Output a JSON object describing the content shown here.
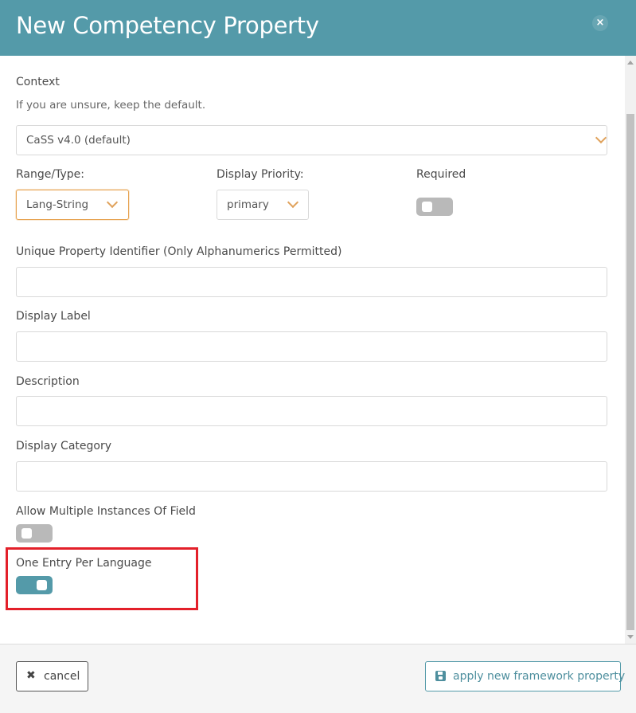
{
  "dialog": {
    "title": "New Competency Property",
    "close_glyph": "×"
  },
  "context": {
    "label": "Context",
    "help": "If you are unsure, keep the default.",
    "selected": "CaSS v4.0 (default)"
  },
  "range_type": {
    "label": "Range/Type:",
    "selected": "Lang-String"
  },
  "display_priority": {
    "label": "Display Priority:",
    "selected": "primary"
  },
  "required": {
    "label": "Required",
    "on": false
  },
  "fields": {
    "unique_id_label": "Unique Property Identifier (Only Alphanumerics Permitted)",
    "unique_id_value": "",
    "display_label_label": "Display Label",
    "display_label_value": "",
    "description_label": "Description",
    "description_value": "",
    "display_category_label": "Display Category",
    "display_category_value": ""
  },
  "allow_multiple": {
    "label": "Allow Multiple Instances Of Field",
    "on": false
  },
  "one_entry_per_language": {
    "label": "One Entry Per Language",
    "on": true
  },
  "footer": {
    "cancel_label": "cancel",
    "cancel_glyph": "✖",
    "apply_label": "apply new framework property"
  },
  "colors": {
    "header": "#549aa9",
    "accent": "#549aa9",
    "chevron": "#e0a25c",
    "highlight_box": "#e3202a"
  },
  "icons": {
    "close": "close-icon",
    "chevron": "chevron-down-icon",
    "cancel": "x-icon",
    "apply": "save-icon"
  }
}
